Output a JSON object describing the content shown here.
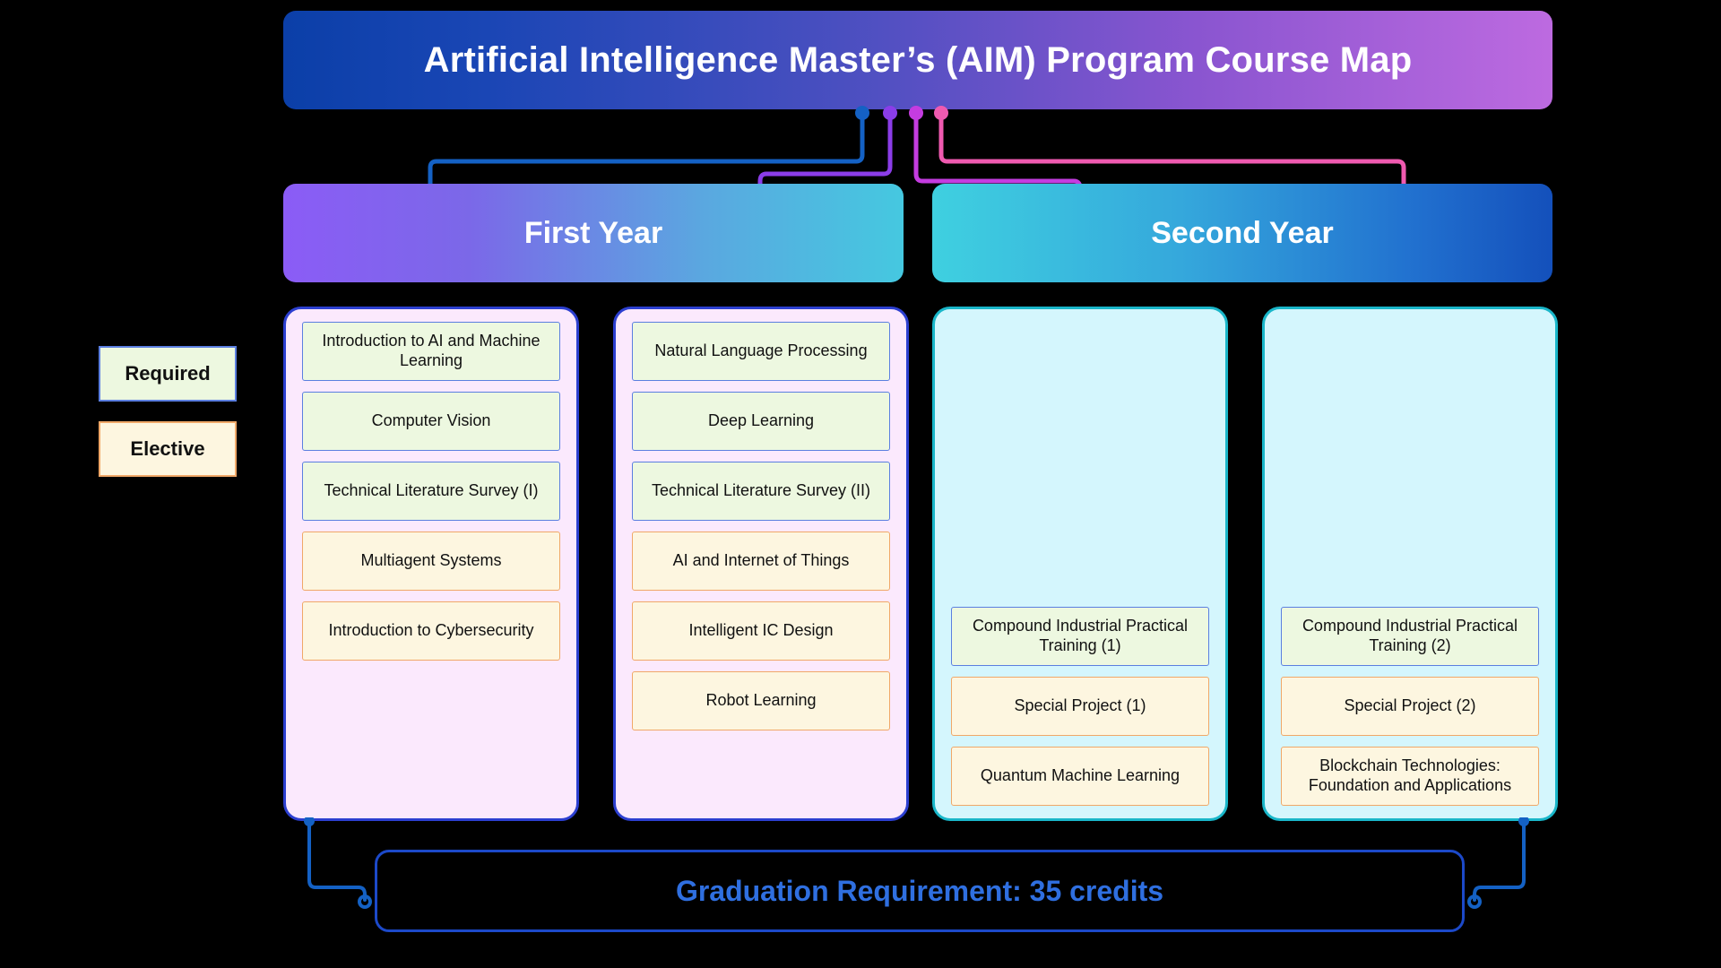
{
  "title": {
    "text": "Artificial Intelligence Master’s (AIM) Program Course Map"
  },
  "legend": {
    "required_label": "Required",
    "elective_label": "Elective",
    "required_fill": "#edf8e0",
    "required_border": "#5b7fe0",
    "elective_fill": "#fdf6e0",
    "elective_border": "#f0a868"
  },
  "years": [
    {
      "label": "First Year"
    },
    {
      "label": "Second Year"
    }
  ],
  "panels": [
    {
      "id": "y1c1",
      "courses": [
        {
          "name": "Introduction to AI and Machine Learning",
          "type": "required"
        },
        {
          "name": "Computer Vision",
          "type": "required"
        },
        {
          "name": "Technical Literature Survey (I)",
          "type": "required"
        },
        {
          "name": "Multiagent Systems",
          "type": "elective"
        },
        {
          "name": "Introduction to Cybersecurity",
          "type": "elective"
        }
      ]
    },
    {
      "id": "y1c2",
      "courses": [
        {
          "name": "Natural Language Processing",
          "type": "required"
        },
        {
          "name": "Deep Learning",
          "type": "required"
        },
        {
          "name": "Technical Literature Survey (II)",
          "type": "required"
        },
        {
          "name": "AI and Internet of Things",
          "type": "elective"
        },
        {
          "name": "Intelligent IC Design",
          "type": "elective"
        },
        {
          "name": "Robot Learning",
          "type": "elective"
        }
      ]
    },
    {
      "id": "y2c1",
      "courses": [
        {
          "name": "Compound Industrial Practical Training (1)",
          "type": "required"
        },
        {
          "name": "Special Project (1)",
          "type": "elective"
        },
        {
          "name": "Quantum Machine Learning",
          "type": "elective"
        }
      ]
    },
    {
      "id": "y2c2",
      "courses": [
        {
          "name": "Compound Industrial Practical Training (2)",
          "type": "required"
        },
        {
          "name": "Special Project (2)",
          "type": "elective"
        },
        {
          "name": "Blockchain Technologies: Foundation and Applications",
          "type": "elective"
        }
      ]
    }
  ],
  "graduation": {
    "text": "Graduation Requirement: 35 credits",
    "text_color": "#2f6fe0",
    "border_color": "#1c49c9"
  },
  "connector_colors": {
    "blue": "#1461c4",
    "purple": "#8b3de8",
    "magenta": "#c43ce0",
    "pink": "#f05ab0"
  }
}
